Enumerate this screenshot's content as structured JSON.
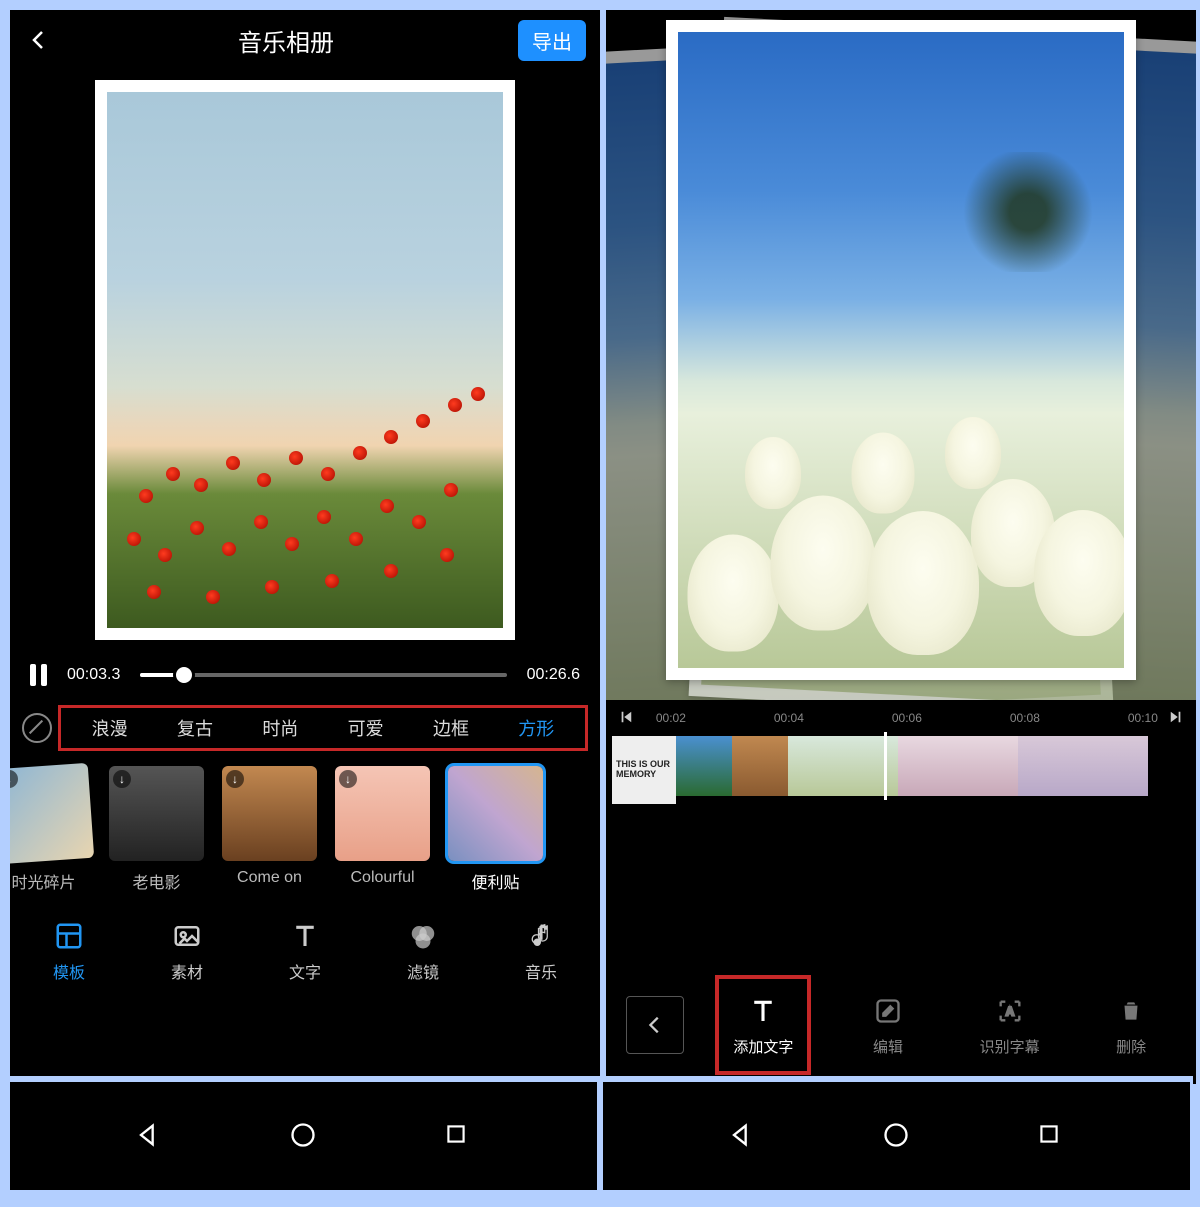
{
  "left": {
    "title": "音乐相册",
    "export_label": "导出",
    "player": {
      "current": "00:03.3",
      "total": "00:26.6",
      "progress_pct": 12
    },
    "categories": [
      "浪漫",
      "复古",
      "时尚",
      "可爱",
      "边框",
      "方形"
    ],
    "category_active_index": 5,
    "templates": [
      {
        "label": "时光碎片",
        "download": true
      },
      {
        "label": "老电影",
        "download": true
      },
      {
        "label": "Come on",
        "download": true
      },
      {
        "label": "Colourful",
        "download": true
      },
      {
        "label": "便利贴",
        "download": false,
        "selected": true
      }
    ],
    "bottom_tabs": [
      {
        "label": "模板",
        "icon": "template-icon",
        "active": true
      },
      {
        "label": "素材",
        "icon": "assets-icon"
      },
      {
        "label": "文字",
        "icon": "text-icon"
      },
      {
        "label": "滤镜",
        "icon": "filter-icon"
      },
      {
        "label": "音乐",
        "icon": "music-icon"
      }
    ]
  },
  "right": {
    "timeline_ticks": [
      "00:02",
      "00:04",
      "00:06",
      "00:08",
      "00:10"
    ],
    "memory_text": "THIS IS OUR MEMORY",
    "tools": [
      {
        "label": "",
        "icon": "back-icon",
        "kind": "back"
      },
      {
        "label": "添加文字",
        "icon": "text-icon",
        "kind": "primary",
        "highlighted": true
      },
      {
        "label": "编辑",
        "icon": "edit-icon",
        "kind": "disabled"
      },
      {
        "label": "识别字幕",
        "icon": "caption-icon",
        "kind": "disabled"
      },
      {
        "label": "删除",
        "icon": "delete-icon",
        "kind": "disabled"
      }
    ]
  },
  "colors": {
    "accent": "#2196f3",
    "highlight": "#c62828"
  }
}
